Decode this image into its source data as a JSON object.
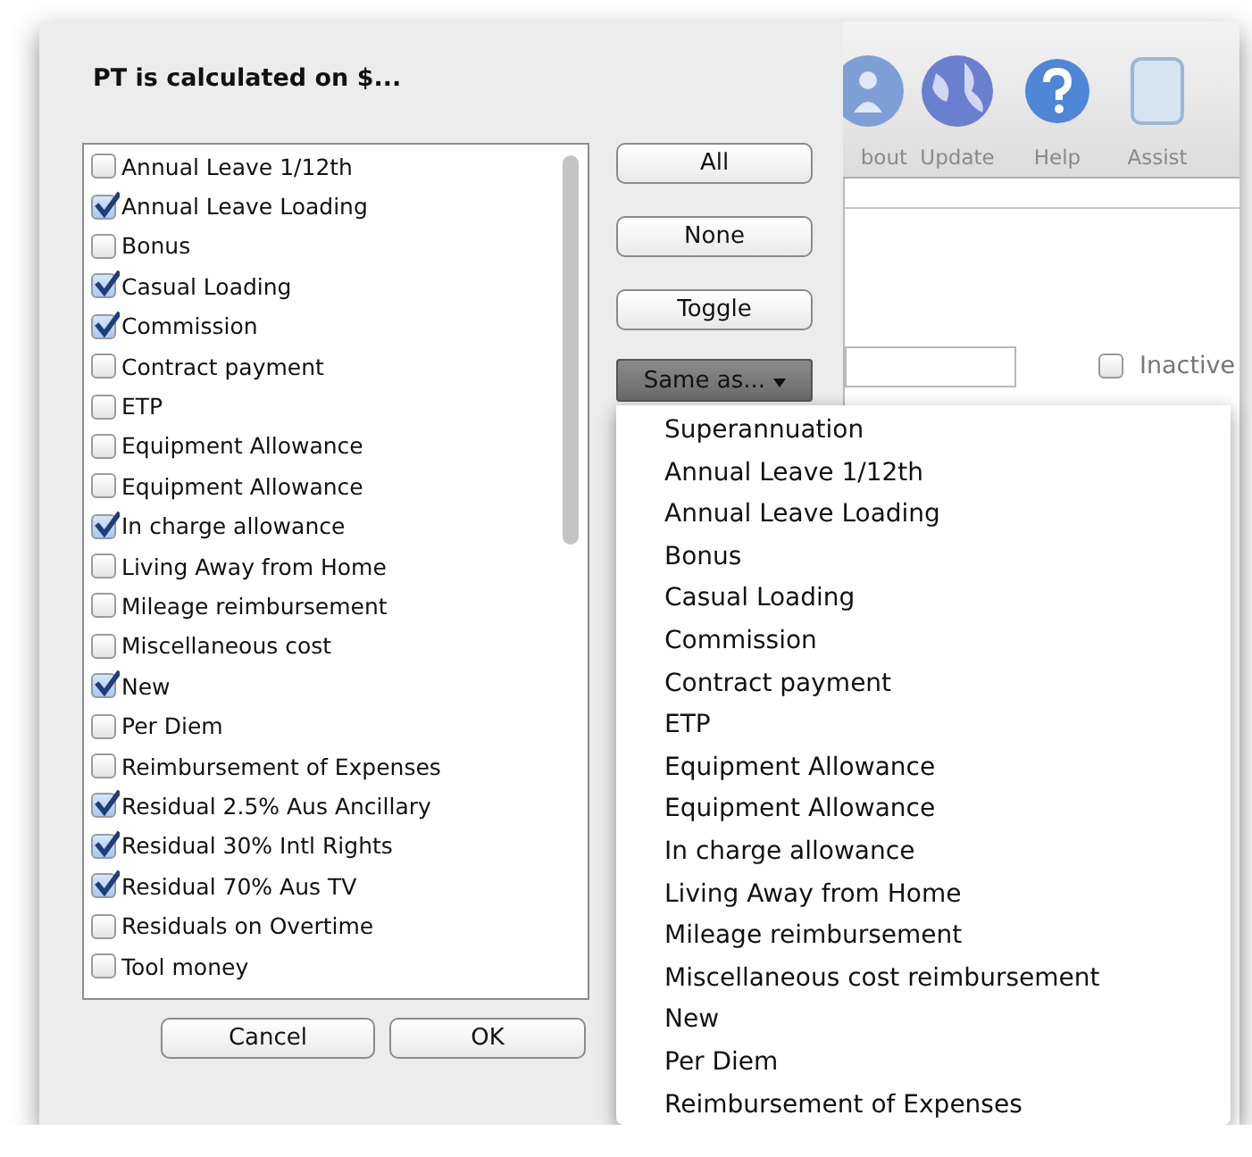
{
  "dialog": {
    "title": "PT is calculated on $...",
    "items": [
      {
        "label": "Annual Leave 1/12th",
        "checked": false
      },
      {
        "label": "Annual Leave Loading",
        "checked": true
      },
      {
        "label": "Bonus",
        "checked": false
      },
      {
        "label": "Casual Loading",
        "checked": true
      },
      {
        "label": "Commission",
        "checked": true
      },
      {
        "label": "Contract payment",
        "checked": false
      },
      {
        "label": "ETP",
        "checked": false
      },
      {
        "label": "Equipment Allowance",
        "checked": false
      },
      {
        "label": "Equipment Allowance",
        "checked": false
      },
      {
        "label": "In charge allowance",
        "checked": true
      },
      {
        "label": "Living Away from Home",
        "checked": false
      },
      {
        "label": "Mileage reimbursement",
        "checked": false
      },
      {
        "label": "Miscellaneous cost",
        "checked": false
      },
      {
        "label": "New",
        "checked": true
      },
      {
        "label": "Per Diem",
        "checked": false
      },
      {
        "label": "Reimbursement of Expenses",
        "checked": false
      },
      {
        "label": "Residual 2.5% Aus Ancillary",
        "checked": true
      },
      {
        "label": "Residual 30% Intl Rights",
        "checked": true
      },
      {
        "label": "Residual 70% Aus TV",
        "checked": true
      },
      {
        "label": "Residuals on Overtime",
        "checked": false
      },
      {
        "label": "Tool money",
        "checked": false
      }
    ],
    "side_buttons": [
      "All",
      "None",
      "Toggle"
    ],
    "same_as": {
      "label": "Same as...",
      "expanded": true
    },
    "footer_buttons": [
      "Cancel",
      "OK"
    ]
  },
  "background_window": {
    "toolbar": [
      "bout",
      "Update",
      "Help",
      "Assist"
    ],
    "inactive": {
      "label": "Inactive",
      "checked": false
    }
  },
  "menu": [
    "Superannuation",
    "Annual Leave 1/12th",
    "Annual Leave Loading",
    "Bonus",
    "Casual Loading",
    "Commission",
    "Contract payment",
    "ETP",
    "Equipment Allowance",
    "Equipment Allowance",
    "In charge allowance",
    "Living Away from Home",
    "Mileage reimbursement",
    "Miscellaneous cost reimbursement",
    "New",
    "Per Diem",
    "Reimbursement of Expenses"
  ]
}
